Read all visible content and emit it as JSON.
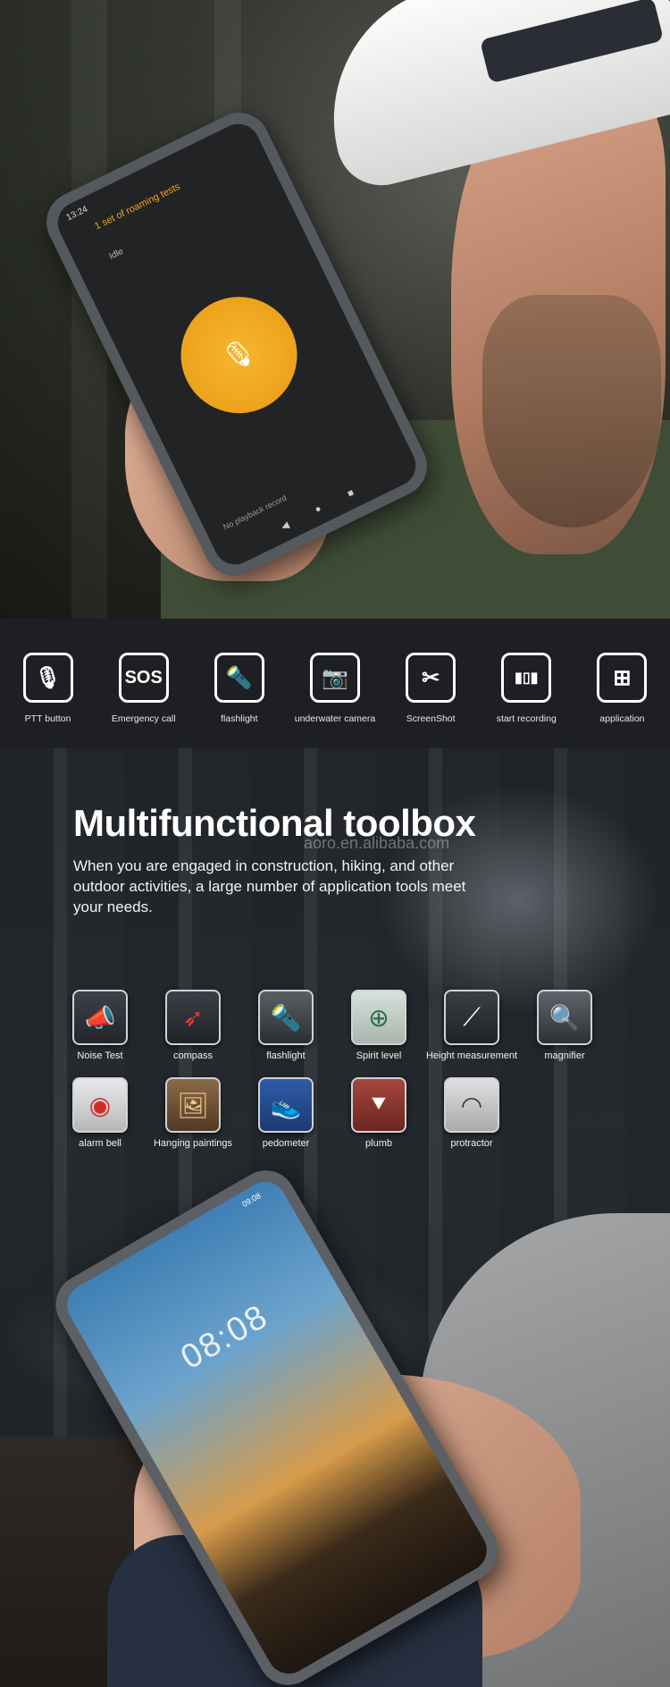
{
  "phone_app": {
    "status_time": "13:24",
    "title": "1 set of roaming tests",
    "state": "Idle",
    "playback": "No playback record"
  },
  "features": [
    {
      "icon": "ptt-icon",
      "glyph": "🎙",
      "label": "PTT button"
    },
    {
      "icon": "sos-icon",
      "glyph": "SOS",
      "label": "Emergency call"
    },
    {
      "icon": "flashlight-icon",
      "glyph": "🔦",
      "label": "flashlight"
    },
    {
      "icon": "camera-icon",
      "glyph": "📷",
      "label": "underwater camera"
    },
    {
      "icon": "scissors-icon",
      "glyph": "✂",
      "label": "ScreenShot"
    },
    {
      "icon": "waveform-icon",
      "glyph": "▮▯▮",
      "label": "start recording"
    },
    {
      "icon": "apps-icon",
      "glyph": "⊞",
      "label": "application"
    }
  ],
  "toolbox": {
    "title": "Multifunctional toolbox",
    "description": "When you are engaged in construction, hiking, and other outdoor activities, a large number of application tools meet your needs.",
    "watermark": "aoro.en.alibaba.com",
    "row1": [
      {
        "icon": "megaphone-icon",
        "glyph": "📣",
        "cls": "ic-noise",
        "label": "Noise Test"
      },
      {
        "icon": "compass-icon",
        "glyph": "➶",
        "cls": "ic-compass",
        "label": "compass"
      },
      {
        "icon": "flashlight-icon",
        "glyph": "🔦",
        "cls": "ic-flash",
        "label": "flashlight"
      },
      {
        "icon": "spirit-level-icon",
        "glyph": "⊕",
        "cls": "ic-spirit",
        "label": "Spirit level"
      },
      {
        "icon": "height-measure-icon",
        "glyph": "⟋",
        "cls": "ic-height",
        "label": "Height measurement"
      },
      {
        "icon": "magnifier-icon",
        "glyph": "🔍",
        "cls": "ic-magnifier",
        "label": "magnifier"
      }
    ],
    "row2": [
      {
        "icon": "alarm-bell-icon",
        "glyph": "◉",
        "cls": "ic-alarm",
        "label": "alarm bell"
      },
      {
        "icon": "painting-icon",
        "glyph": "🖼",
        "cls": "ic-paint",
        "label": "Hanging paintings"
      },
      {
        "icon": "shoe-icon",
        "glyph": "👟",
        "cls": "ic-pedo",
        "label": "pedometer"
      },
      {
        "icon": "plumb-icon",
        "glyph": "⯆",
        "cls": "ic-plumb",
        "label": "plumb"
      },
      {
        "icon": "protractor-icon",
        "glyph": "◠",
        "cls": "ic-protractor",
        "label": "protractor"
      }
    ]
  },
  "phone_lock": {
    "clock": "08:08",
    "status": "09:08"
  }
}
